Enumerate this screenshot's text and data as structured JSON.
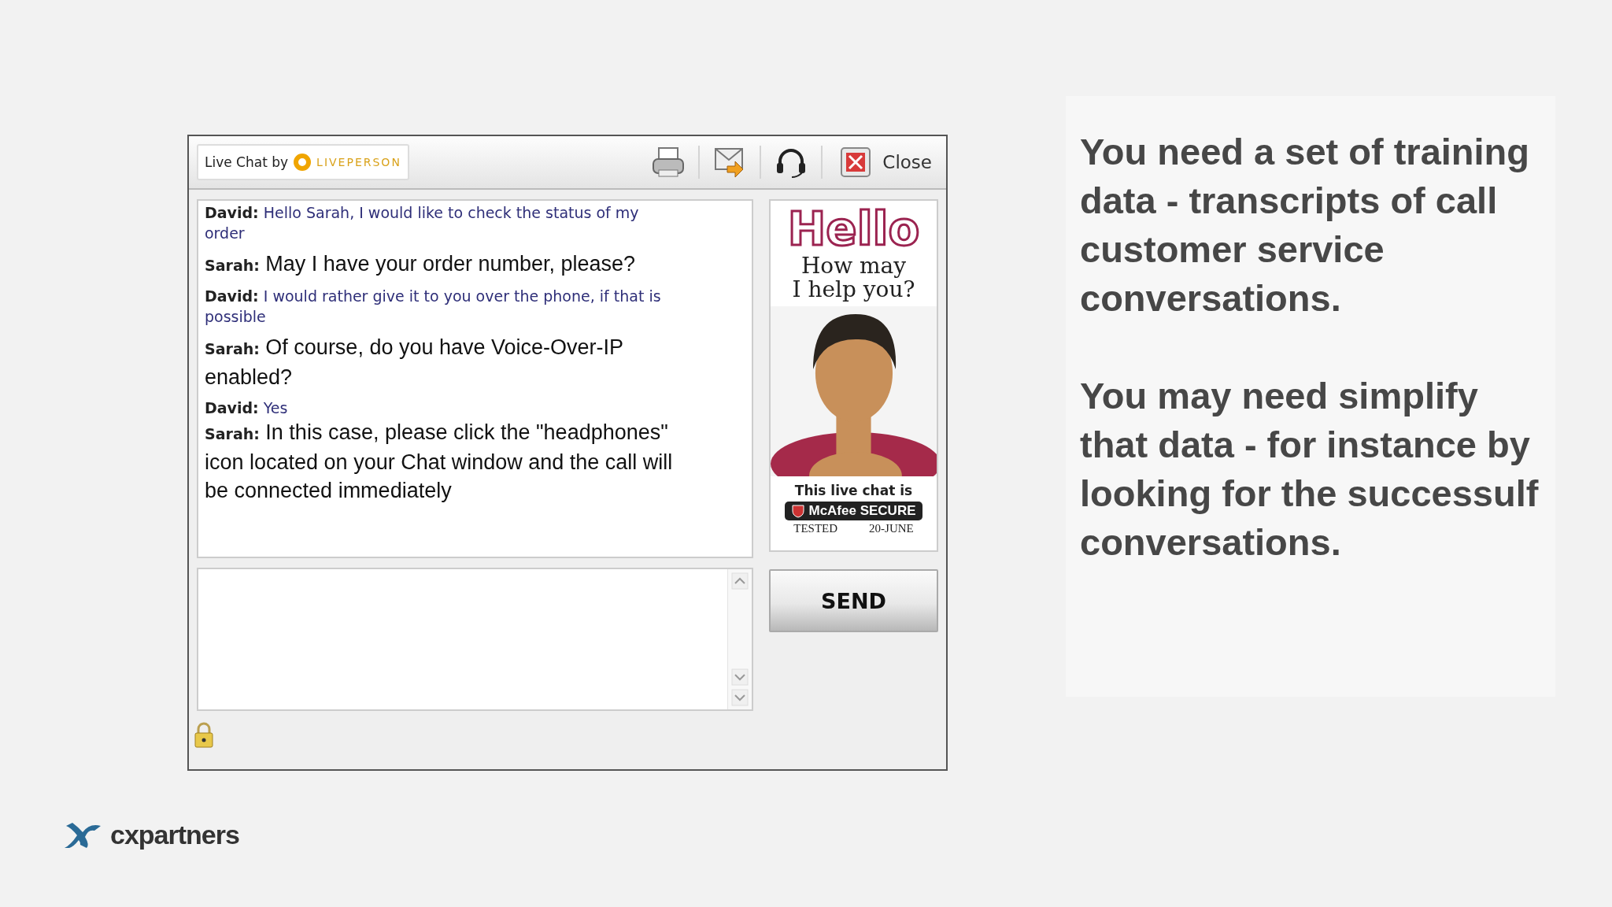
{
  "chat_window": {
    "branding": {
      "label": "Live Chat by",
      "brand": "LIVEPERSON"
    },
    "toolbar": {
      "close_label": "Close"
    },
    "messages": [
      {
        "sender": "David:",
        "text": "Hello Sarah, I would like to check the status of my order",
        "kind": "visitor"
      },
      {
        "sender": "Sarah:",
        "text": "May I have your order number, please?",
        "kind": "agent"
      },
      {
        "sender": "David:",
        "text": "I would rather give it to you over the phone, if that is possible",
        "kind": "visitor"
      },
      {
        "sender": "Sarah:",
        "text": "Of course, do you have Voice-Over-IP enabled?",
        "kind": "agent"
      },
      {
        "sender": "David:",
        "text": "Yes",
        "kind": "visitor"
      },
      {
        "sender": "Sarah:",
        "text": "In this case, please click the \"headphones\" icon located on your Chat window and the call will be connected immediately",
        "kind": "agent"
      }
    ],
    "ad": {
      "headline": "Hello",
      "tagline": [
        "How may",
        "I help you?"
      ],
      "footer": "This live chat is",
      "badge": "McAfee SECURE",
      "badge_left": "TESTED",
      "badge_right": "20-JUNE"
    },
    "send_button": "SEND"
  },
  "notes": [
    "You need a set of training data - transcripts of call customer service conversations.",
    "You may need simplify that data - for instance by looking for the successulf conversations."
  ],
  "footer_logo": "cxpartners"
}
